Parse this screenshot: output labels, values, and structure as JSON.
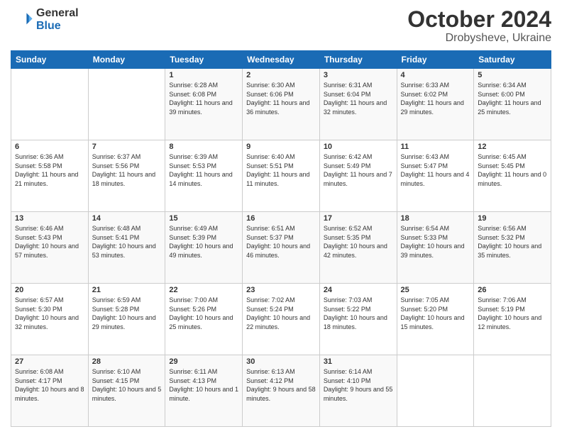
{
  "logo": {
    "line1": "General",
    "line2": "Blue"
  },
  "header": {
    "month": "October 2024",
    "location": "Drobysheve, Ukraine"
  },
  "weekdays": [
    "Sunday",
    "Monday",
    "Tuesday",
    "Wednesday",
    "Thursday",
    "Friday",
    "Saturday"
  ],
  "weeks": [
    [
      {
        "day": "",
        "info": ""
      },
      {
        "day": "",
        "info": ""
      },
      {
        "day": "1",
        "info": "Sunrise: 6:28 AM\nSunset: 6:08 PM\nDaylight: 11 hours and 39 minutes."
      },
      {
        "day": "2",
        "info": "Sunrise: 6:30 AM\nSunset: 6:06 PM\nDaylight: 11 hours and 36 minutes."
      },
      {
        "day": "3",
        "info": "Sunrise: 6:31 AM\nSunset: 6:04 PM\nDaylight: 11 hours and 32 minutes."
      },
      {
        "day": "4",
        "info": "Sunrise: 6:33 AM\nSunset: 6:02 PM\nDaylight: 11 hours and 29 minutes."
      },
      {
        "day": "5",
        "info": "Sunrise: 6:34 AM\nSunset: 6:00 PM\nDaylight: 11 hours and 25 minutes."
      }
    ],
    [
      {
        "day": "6",
        "info": "Sunrise: 6:36 AM\nSunset: 5:58 PM\nDaylight: 11 hours and 21 minutes."
      },
      {
        "day": "7",
        "info": "Sunrise: 6:37 AM\nSunset: 5:56 PM\nDaylight: 11 hours and 18 minutes."
      },
      {
        "day": "8",
        "info": "Sunrise: 6:39 AM\nSunset: 5:53 PM\nDaylight: 11 hours and 14 minutes."
      },
      {
        "day": "9",
        "info": "Sunrise: 6:40 AM\nSunset: 5:51 PM\nDaylight: 11 hours and 11 minutes."
      },
      {
        "day": "10",
        "info": "Sunrise: 6:42 AM\nSunset: 5:49 PM\nDaylight: 11 hours and 7 minutes."
      },
      {
        "day": "11",
        "info": "Sunrise: 6:43 AM\nSunset: 5:47 PM\nDaylight: 11 hours and 4 minutes."
      },
      {
        "day": "12",
        "info": "Sunrise: 6:45 AM\nSunset: 5:45 PM\nDaylight: 11 hours and 0 minutes."
      }
    ],
    [
      {
        "day": "13",
        "info": "Sunrise: 6:46 AM\nSunset: 5:43 PM\nDaylight: 10 hours and 57 minutes."
      },
      {
        "day": "14",
        "info": "Sunrise: 6:48 AM\nSunset: 5:41 PM\nDaylight: 10 hours and 53 minutes."
      },
      {
        "day": "15",
        "info": "Sunrise: 6:49 AM\nSunset: 5:39 PM\nDaylight: 10 hours and 49 minutes."
      },
      {
        "day": "16",
        "info": "Sunrise: 6:51 AM\nSunset: 5:37 PM\nDaylight: 10 hours and 46 minutes."
      },
      {
        "day": "17",
        "info": "Sunrise: 6:52 AM\nSunset: 5:35 PM\nDaylight: 10 hours and 42 minutes."
      },
      {
        "day": "18",
        "info": "Sunrise: 6:54 AM\nSunset: 5:33 PM\nDaylight: 10 hours and 39 minutes."
      },
      {
        "day": "19",
        "info": "Sunrise: 6:56 AM\nSunset: 5:32 PM\nDaylight: 10 hours and 35 minutes."
      }
    ],
    [
      {
        "day": "20",
        "info": "Sunrise: 6:57 AM\nSunset: 5:30 PM\nDaylight: 10 hours and 32 minutes."
      },
      {
        "day": "21",
        "info": "Sunrise: 6:59 AM\nSunset: 5:28 PM\nDaylight: 10 hours and 29 minutes."
      },
      {
        "day": "22",
        "info": "Sunrise: 7:00 AM\nSunset: 5:26 PM\nDaylight: 10 hours and 25 minutes."
      },
      {
        "day": "23",
        "info": "Sunrise: 7:02 AM\nSunset: 5:24 PM\nDaylight: 10 hours and 22 minutes."
      },
      {
        "day": "24",
        "info": "Sunrise: 7:03 AM\nSunset: 5:22 PM\nDaylight: 10 hours and 18 minutes."
      },
      {
        "day": "25",
        "info": "Sunrise: 7:05 AM\nSunset: 5:20 PM\nDaylight: 10 hours and 15 minutes."
      },
      {
        "day": "26",
        "info": "Sunrise: 7:06 AM\nSunset: 5:19 PM\nDaylight: 10 hours and 12 minutes."
      }
    ],
    [
      {
        "day": "27",
        "info": "Sunrise: 6:08 AM\nSunset: 4:17 PM\nDaylight: 10 hours and 8 minutes."
      },
      {
        "day": "28",
        "info": "Sunrise: 6:10 AM\nSunset: 4:15 PM\nDaylight: 10 hours and 5 minutes."
      },
      {
        "day": "29",
        "info": "Sunrise: 6:11 AM\nSunset: 4:13 PM\nDaylight: 10 hours and 1 minute."
      },
      {
        "day": "30",
        "info": "Sunrise: 6:13 AM\nSunset: 4:12 PM\nDaylight: 9 hours and 58 minutes."
      },
      {
        "day": "31",
        "info": "Sunrise: 6:14 AM\nSunset: 4:10 PM\nDaylight: 9 hours and 55 minutes."
      },
      {
        "day": "",
        "info": ""
      },
      {
        "day": "",
        "info": ""
      }
    ]
  ]
}
